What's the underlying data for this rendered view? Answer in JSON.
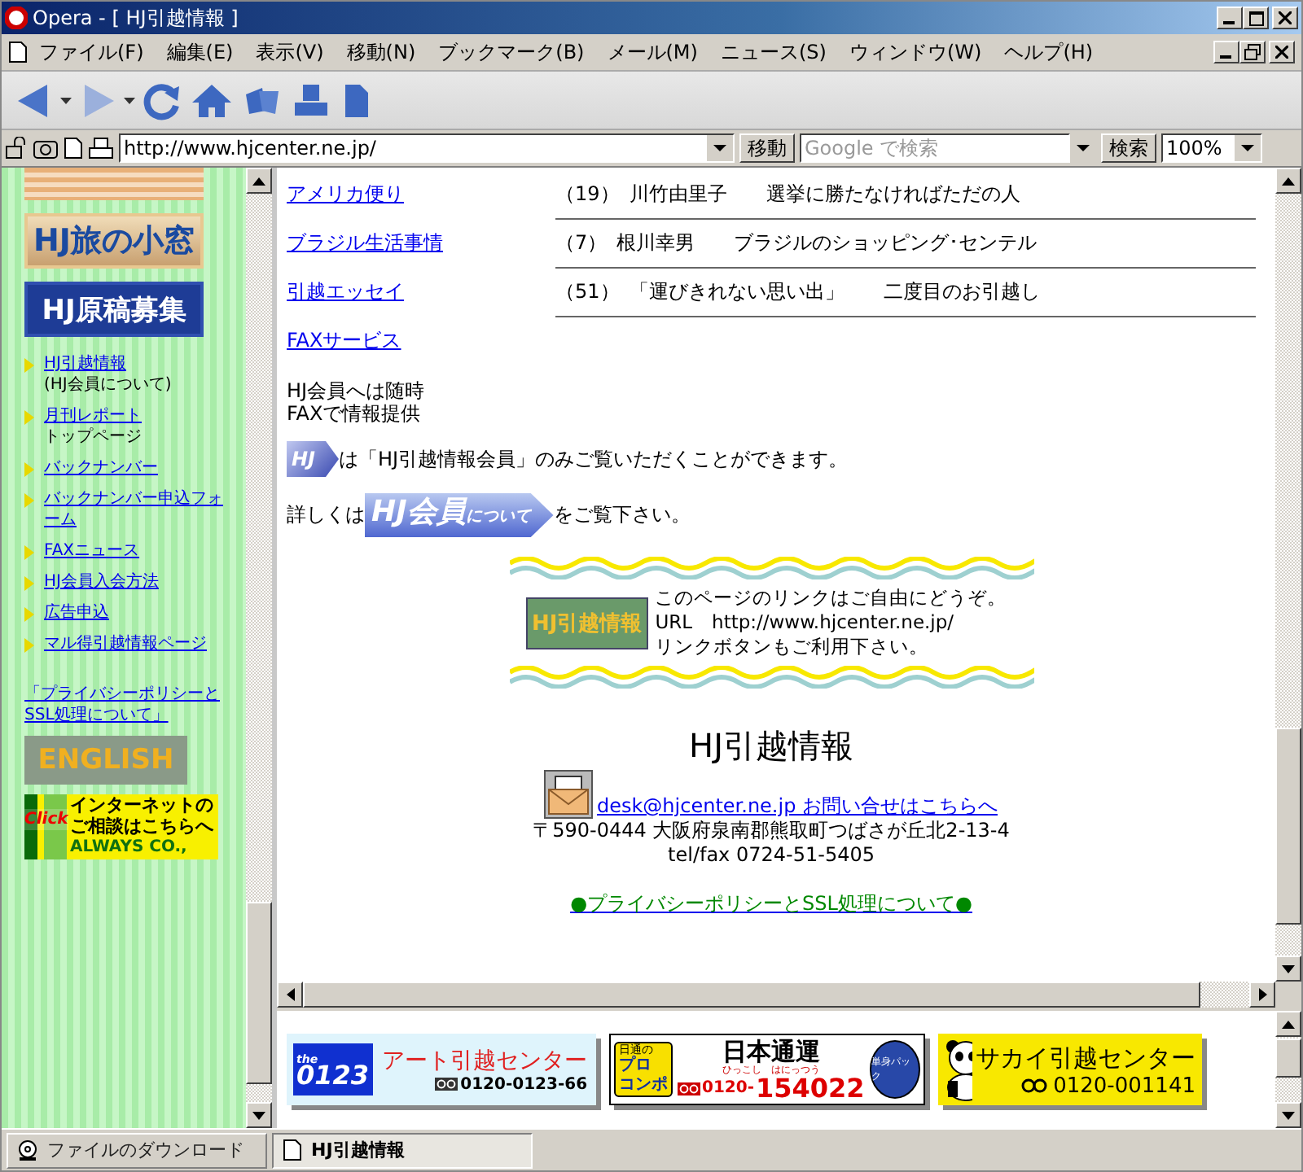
{
  "window": {
    "title": "Opera - [ HJ引越情報 ]"
  },
  "menu": [
    "ファイル(F)",
    "編集(E)",
    "表示(V)",
    "移動(N)",
    "ブックマーク(B)",
    "メール(M)",
    "ニュース(S)",
    "ウィンドウ(W)",
    "ヘルプ(H)"
  ],
  "address_bar": {
    "url": "http://www.hjcenter.ne.jp/",
    "go_button": "移動",
    "search_placeholder": "Google で検索",
    "search_button": "検索",
    "zoom": "100%"
  },
  "sidebar": {
    "banners": [
      {
        "kind": "tan",
        "text": "HJ旅の小窓"
      },
      {
        "kind": "navy",
        "text": "HJ原稿募集"
      }
    ],
    "links": [
      {
        "label": "HJ引越情報",
        "note": "(HJ会員について)"
      },
      {
        "label": "月刊レポート",
        "note": "トップページ"
      },
      {
        "label": "バックナンバー"
      },
      {
        "label": "バックナンバー申込フォーム"
      },
      {
        "label": "FAXニュース"
      },
      {
        "label": "HJ会員入会方法"
      },
      {
        "label": "広告申込"
      },
      {
        "label": "マル得引越情報ページ"
      }
    ],
    "privacy_link": "「プライバシーポリシーとSSL処理について」",
    "english_banner": "ENGLISH",
    "consult_banner": {
      "click": "Click",
      "line_1": "インターネットの",
      "line_2": "ご相談はこちらへ",
      "company": "ALWAYS CO.,"
    }
  },
  "main": {
    "columns": [
      {
        "link": "アメリカ便り",
        "number": "（19）",
        "author": "川竹由里子",
        "subject": "選挙に勝たなければただの人"
      },
      {
        "link": "ブラジル生活事情",
        "number": "（7）",
        "author": "根川幸男",
        "subject": "ブラジルのショッピング･センテル"
      },
      {
        "link": "引越エッセイ",
        "number": "（51）",
        "author": "「運びきれない思い出」",
        "subject": "二度目のお引越し"
      }
    ],
    "fax_link": "FAXサービス",
    "fax_note": [
      "HJ会員へは随時",
      "FAXで情報提供"
    ],
    "member_badge": "HJ",
    "member_note": "は「HJ引越情報会員」のみご覧いただくことができます。",
    "details_prefix": "詳しくは",
    "member_button": {
      "main": "HJ会員",
      "small": "について"
    },
    "details_suffix": "をご覧下さい。",
    "link_box": {
      "badge": "HJ引越情報",
      "lines": [
        "このページのリンクはご自由にどうぞ。",
        "URL　http://www.hjcenter.ne.jp/",
        "リンクボタンもご利用下さい。"
      ]
    },
    "footer": {
      "title": "HJ引越情報",
      "email_link": "desk@hjcenter.ne.jp お問い合せはこちらへ",
      "address": "〒590-0444 大阪府泉南郡熊取町つばさが丘北2-13-4",
      "tel": "tel/fax 0724-51-5405",
      "privacy_link": "●プライバシーポリシーとSSL処理について●"
    }
  },
  "ads": [
    {
      "kind": "art",
      "logo_small": "the",
      "logo": "0123",
      "name": "アート引越センター",
      "phone": "0120-0123-66"
    },
    {
      "kind": "nittsu",
      "badge_top": "日通の",
      "badge_1": "プロ",
      "badge_2": "コンポ",
      "name": "日本通運",
      "phone_prefix": "0120-",
      "phone": "154022",
      "reading": "ひっこし　はにっつう",
      "seal": "単身パック"
    },
    {
      "kind": "sakai",
      "name": "サカイ引越センター",
      "phone": "0120-001141"
    }
  ],
  "tabs": [
    {
      "label": "ファイルのダウンロード",
      "selected": false
    },
    {
      "label": "HJ引越情報",
      "selected": true
    }
  ]
}
